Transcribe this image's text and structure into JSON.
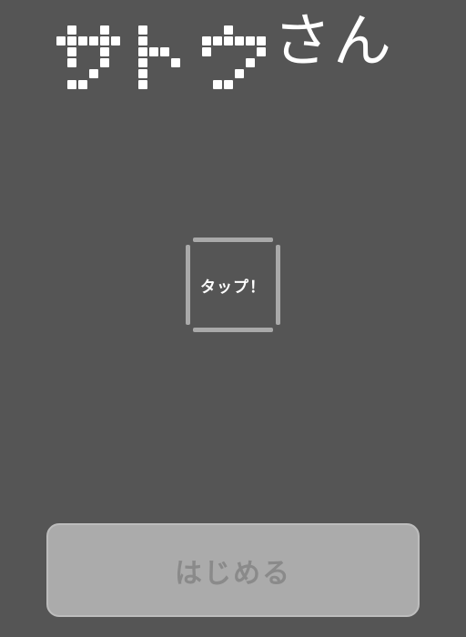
{
  "title": {
    "dot_part": "サトウ",
    "script_part": "さん"
  },
  "tap": {
    "label": "タップ！"
  },
  "start": {
    "label": "はじめる"
  },
  "colors": {
    "background": "#555555",
    "title": "#ffffff",
    "tap_border": "#a9a9a9",
    "button_bg": "#ababab",
    "button_text": "#8a8a8a"
  }
}
